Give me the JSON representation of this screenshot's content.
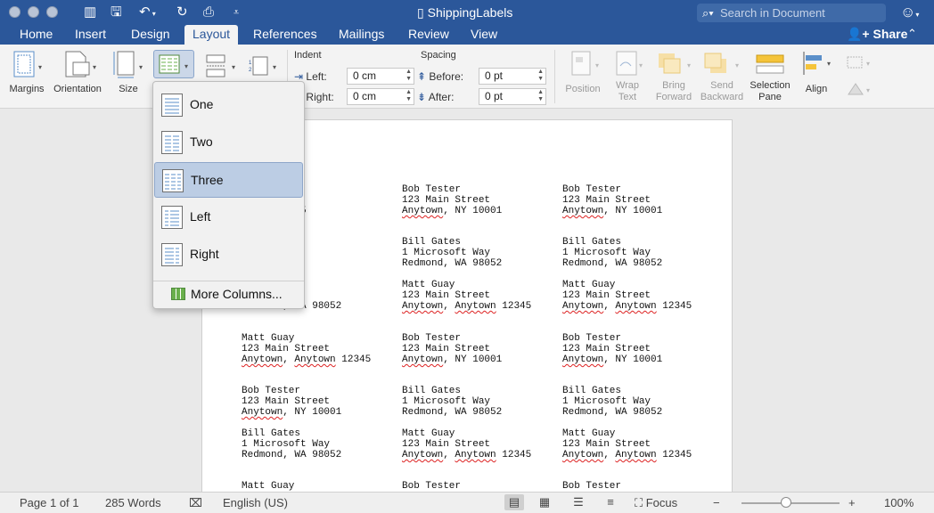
{
  "titlebar": {
    "doc_title": "ShippingLabels",
    "search_placeholder": "Search in Document"
  },
  "tabs": [
    "Home",
    "Insert",
    "Design",
    "Layout",
    "References",
    "Mailings",
    "Review",
    "View"
  ],
  "active_tab": "Layout",
  "share_label": "Share",
  "ribbon": {
    "margins": "Margins",
    "orientation": "Orientation",
    "size": "Size",
    "indent_title": "Indent",
    "indent_left_label": "Left:",
    "indent_left_value": "0 cm",
    "indent_right_label": "Right:",
    "indent_right_value": "0 cm",
    "spacing_title": "Spacing",
    "spacing_before_label": "Before:",
    "spacing_before_value": "0 pt",
    "spacing_after_label": "After:",
    "spacing_after_value": "0 pt",
    "position": "Position",
    "wrap_text": "Wrap\nText",
    "bring_forward": "Bring\nForward",
    "send_backward": "Send\nBackward",
    "selection_pane": "Selection\nPane",
    "align": "Align"
  },
  "columns_menu": {
    "items": [
      "One",
      "Two",
      "Three",
      "Left",
      "Right"
    ],
    "selected": "Three",
    "more": "More Columns..."
  },
  "labels": {
    "row0": [
      {
        "l1": "",
        "l2": "reet",
        "l3a": "",
        "l3b": "ytown",
        "l3c": " 12345"
      },
      {
        "l1": "Bob Tester",
        "l2": "123 Main Street",
        "l3a": "Anytown",
        "l3b": "",
        "l3c": ", NY 10001"
      },
      {
        "l1": "Bob Tester",
        "l2": "123 Main Street",
        "l3a": "Anytown",
        "l3b": "",
        "l3c": ", NY 10001"
      }
    ],
    "row1": [
      {
        "l1": "",
        "l2": "reet",
        "l3a": "",
        "l3b": "",
        "l3c": "10001"
      },
      {
        "l1": "Bill Gates",
        "l2": "1 Microsoft Way",
        "l3a": "",
        "l3b": "",
        "l3c": "Redmond, WA 98052"
      },
      {
        "l1": "Bill Gates",
        "l2": "1 Microsoft Way",
        "l3a": "",
        "l3b": "",
        "l3c": "Redmond, WA 98052"
      }
    ],
    "row2": [
      {
        "l1": "",
        "l2": "Way",
        "l3a": "",
        "l3b": "",
        "l3c": "Redmond, WA 98052"
      },
      {
        "l1": "Matt Guay",
        "l2": "123 Main Street",
        "l3a": "Anytown",
        "l3b": "Anytown",
        "l3c": " 12345"
      },
      {
        "l1": "Matt Guay",
        "l2": "123 Main Street",
        "l3a": "Anytown",
        "l3b": "Anytown",
        "l3c": " 12345"
      }
    ],
    "row3": [
      {
        "l1": "Matt Guay",
        "l2": "123 Main Street",
        "l3a": "Anytown",
        "l3b": "Anytown",
        "l3c": " 12345"
      },
      {
        "l1": "Bob Tester",
        "l2": "123 Main Street",
        "l3a": "Anytown",
        "l3b": "",
        "l3c": ", NY 10001"
      },
      {
        "l1": "Bob Tester",
        "l2": "123 Main Street",
        "l3a": "Anytown",
        "l3b": "",
        "l3c": ", NY 10001"
      }
    ],
    "row4": [
      {
        "l1": "Bob Tester",
        "l2": "123 Main Street",
        "l3a": "Anytown",
        "l3b": "",
        "l3c": ", NY 10001"
      },
      {
        "l1": "Bill Gates",
        "l2": "1 Microsoft Way",
        "l3a": "",
        "l3b": "",
        "l3c": "Redmond, WA 98052"
      },
      {
        "l1": "Bill Gates",
        "l2": "1 Microsoft Way",
        "l3a": "",
        "l3b": "",
        "l3c": "Redmond, WA 98052"
      }
    ],
    "row5": [
      {
        "l1": "Bill Gates",
        "l2": "1 Microsoft Way",
        "l3a": "",
        "l3b": "",
        "l3c": "Redmond, WA 98052"
      },
      {
        "l1": "Matt Guay",
        "l2": "123 Main Street",
        "l3a": "Anytown",
        "l3b": "Anytown",
        "l3c": " 12345"
      },
      {
        "l1": "Matt Guay",
        "l2": "123 Main Street",
        "l3a": "Anytown",
        "l3b": "Anytown",
        "l3c": " 12345"
      }
    ],
    "row6": [
      {
        "l1": "Matt Guay"
      },
      {
        "l1": "Bob Tester"
      },
      {
        "l1": "Bob Tester"
      }
    ]
  },
  "statusbar": {
    "page": "Page 1 of 1",
    "words": "285 Words",
    "language": "English (US)",
    "focus": "Focus",
    "zoom": "100%",
    "zoom_minus": "−",
    "zoom_plus": "+",
    "zoom_level": 1.0
  },
  "colors": {
    "accent": "#2b579a",
    "selected_menu": "#bccde4"
  }
}
